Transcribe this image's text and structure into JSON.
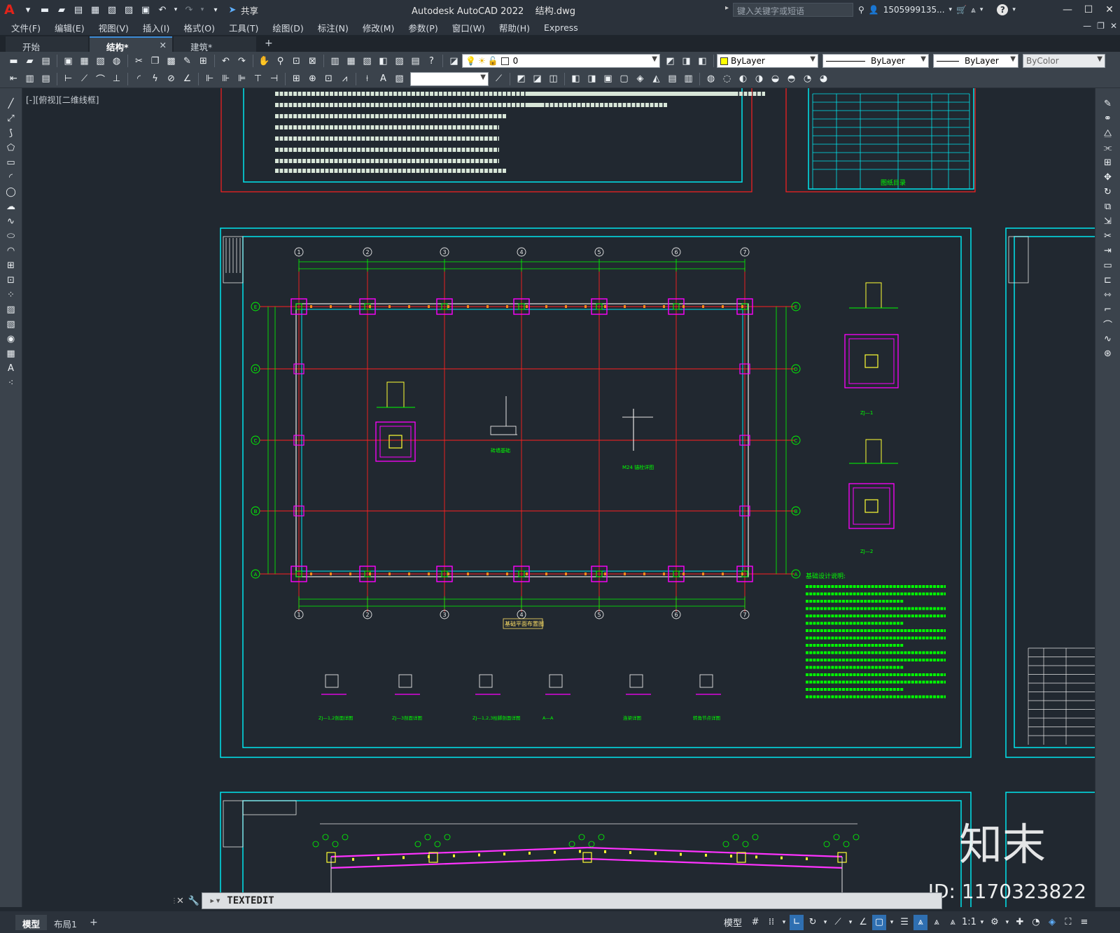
{
  "app": {
    "title": "Autodesk AutoCAD 2022",
    "filename": "结构.dwg",
    "share_label": "共享",
    "search_placeholder": "键入关键字或短语",
    "user": "1505999135...",
    "logo": "A"
  },
  "menu": [
    "文件(F)",
    "编辑(E)",
    "视图(V)",
    "插入(I)",
    "格式(O)",
    "工具(T)",
    "绘图(D)",
    "标注(N)",
    "修改(M)",
    "参数(P)",
    "窗口(W)",
    "帮助(H)",
    "Express"
  ],
  "tabs": [
    {
      "label": "开始",
      "active": false,
      "closable": false
    },
    {
      "label": "结构*",
      "active": true,
      "closable": true
    },
    {
      "label": "建筑*",
      "active": false,
      "closable": false
    }
  ],
  "properties": {
    "layer_value": "0",
    "color": "ByLayer",
    "linetype": "ByLayer",
    "lineweight": "ByLayer",
    "plotstyle": "ByColor",
    "color_swatch": "#ffff00"
  },
  "viewport_label": "[-][俯视][二维线框]",
  "command": {
    "text": "TEXTEDIT"
  },
  "layout_tabs": [
    {
      "label": "模型",
      "active": true
    },
    {
      "label": "布局1",
      "active": false
    }
  ],
  "status": {
    "model_label": "模型",
    "scale": "1:1"
  },
  "watermark": {
    "brand": "知末",
    "id": "ID: 1170323822"
  },
  "drawing": {
    "axis_numbers": [
      "1",
      "2",
      "3",
      "4",
      "5",
      "6",
      "7"
    ],
    "axis_letters": [
      "E",
      "D",
      "C",
      "B",
      "A"
    ],
    "plan_title": "基础平面布置图",
    "detail_titles": [
      "ZJ—1,2剖面详图",
      "ZJ—3剖面详图",
      "ZJ—1,2,3柱脚剖面详图",
      "A—A",
      "连梁详图",
      "转角节点详图"
    ],
    "notes_heading": "基础设计说明:",
    "section_labels": [
      "ZJ—1",
      "ZJ—2"
    ],
    "center_labels": [
      "砖墙基础",
      "M24 锚栓详图"
    ],
    "toc_label": "图纸目录",
    "colors": {
      "frame": "#00e5ee",
      "grid": "#ff2020",
      "dim": "#00ff00",
      "column": "#ff00ff",
      "beam": "#e5e5e5",
      "purlin": "#ff33ff"
    }
  }
}
